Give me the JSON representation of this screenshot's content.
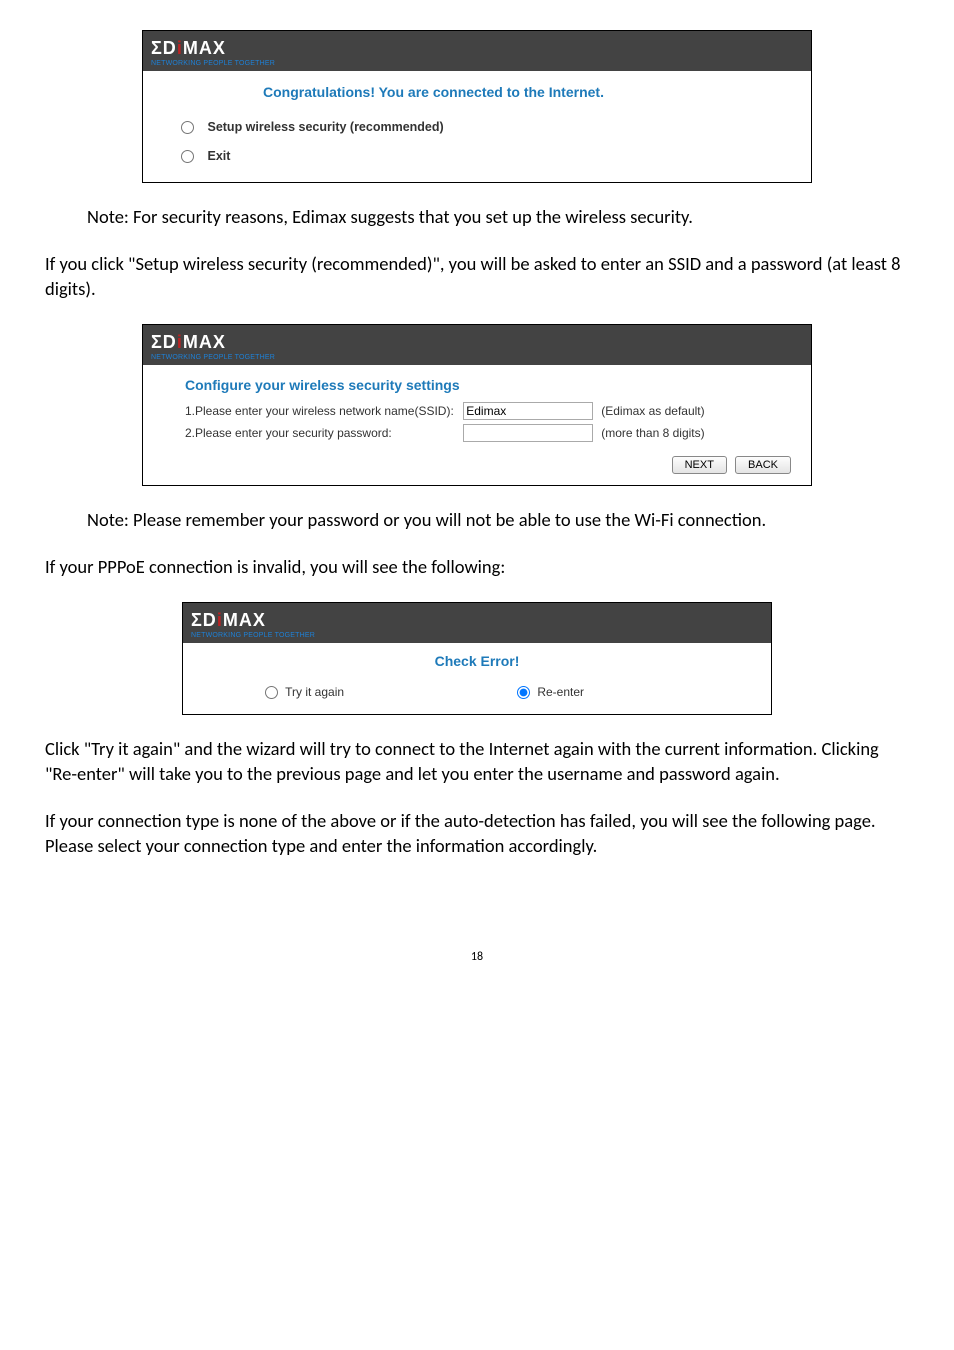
{
  "brand": {
    "logo_prefix": "ΣD",
    "logo_i": "i",
    "logo_suffix": "MAX",
    "tagline": "NETWORKING PEOPLE TOGETHER"
  },
  "panel1": {
    "heading": "Congratulations! You are connected to the Internet.",
    "opt_setup": "Setup wireless security (recommended)",
    "opt_exit": "Exit"
  },
  "para1": "Note: For security reasons, Edimax suggests that you set up the wireless security.",
  "para2": "If you click \"Setup wireless security (recommended)\", you will be asked to enter an SSID and a password (at least 8 digits).",
  "panel2": {
    "heading": "Configure your wireless security settings",
    "row1_label": "1.Please enter your wireless network name(SSID):",
    "row1_value": "Edimax",
    "row1_note": "(Edimax as default)",
    "row2_label": "2.Please enter your security password:",
    "row2_note": "(more than 8 digits)",
    "btn_next": "NEXT",
    "btn_back": "BACK"
  },
  "para3": "Note: Please remember your password or you will not be able to use the Wi-Fi connection.",
  "para4": "If your PPPoE connection is invalid, you will see the following:",
  "panel3": {
    "heading": "Check Error!",
    "opt_try": "Try it again",
    "opt_reenter": "Re-enter"
  },
  "para5": "Click \"Try it again\" and the wizard will try to connect to the Internet again with the current information. Clicking \"Re-enter\" will take you to the previous page and let you enter the username and password again.",
  "para6": "If your connection type is none of the above or if the auto-detection has failed, you will see the following page. Please select your connection type and enter the information accordingly.",
  "page_num": "18"
}
